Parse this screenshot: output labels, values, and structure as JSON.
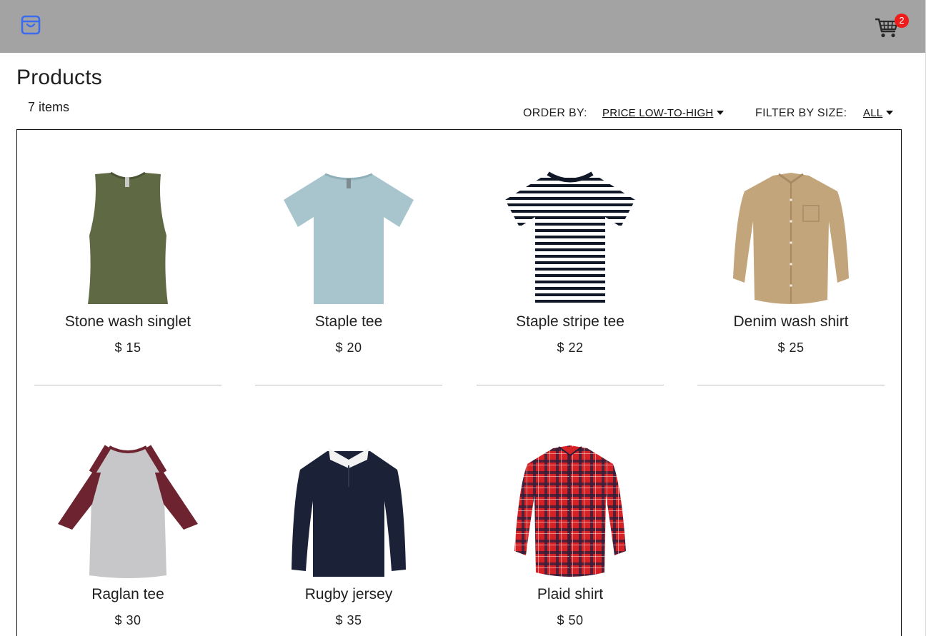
{
  "header": {
    "logo_icon": "shopping-bag-icon",
    "cart_icon": "shopping-cart-icon",
    "cart_count": "2",
    "accent_color": "#3b6cf0",
    "badge_color": "#ef1c1c"
  },
  "main": {
    "title": "Products",
    "item_count": "7 items",
    "order_by": {
      "label": "ORDER BY:",
      "value": "PRICE LOW-TO-HIGH"
    },
    "filter_by_size": {
      "label": "FILTER BY SIZE:",
      "value": "ALL"
    }
  },
  "products": [
    {
      "name": "Stone wash singlet",
      "price": "$ 15",
      "image": "olive-green-singlet"
    },
    {
      "name": "Staple tee",
      "price": "$ 20",
      "image": "light-blue-tshirt"
    },
    {
      "name": "Staple stripe tee",
      "price": "$ 22",
      "image": "black-white-striped-tshirt"
    },
    {
      "name": "Denim wash shirt",
      "price": "$ 25",
      "image": "tan-button-up-shirt"
    },
    {
      "name": "Raglan tee",
      "price": "$ 30",
      "image": "grey-maroon-raglan-tee"
    },
    {
      "name": "Rugby jersey",
      "price": "$ 35",
      "image": "navy-rugby-jersey"
    },
    {
      "name": "Plaid shirt",
      "price": "$ 50",
      "image": "red-plaid-shirt"
    }
  ]
}
